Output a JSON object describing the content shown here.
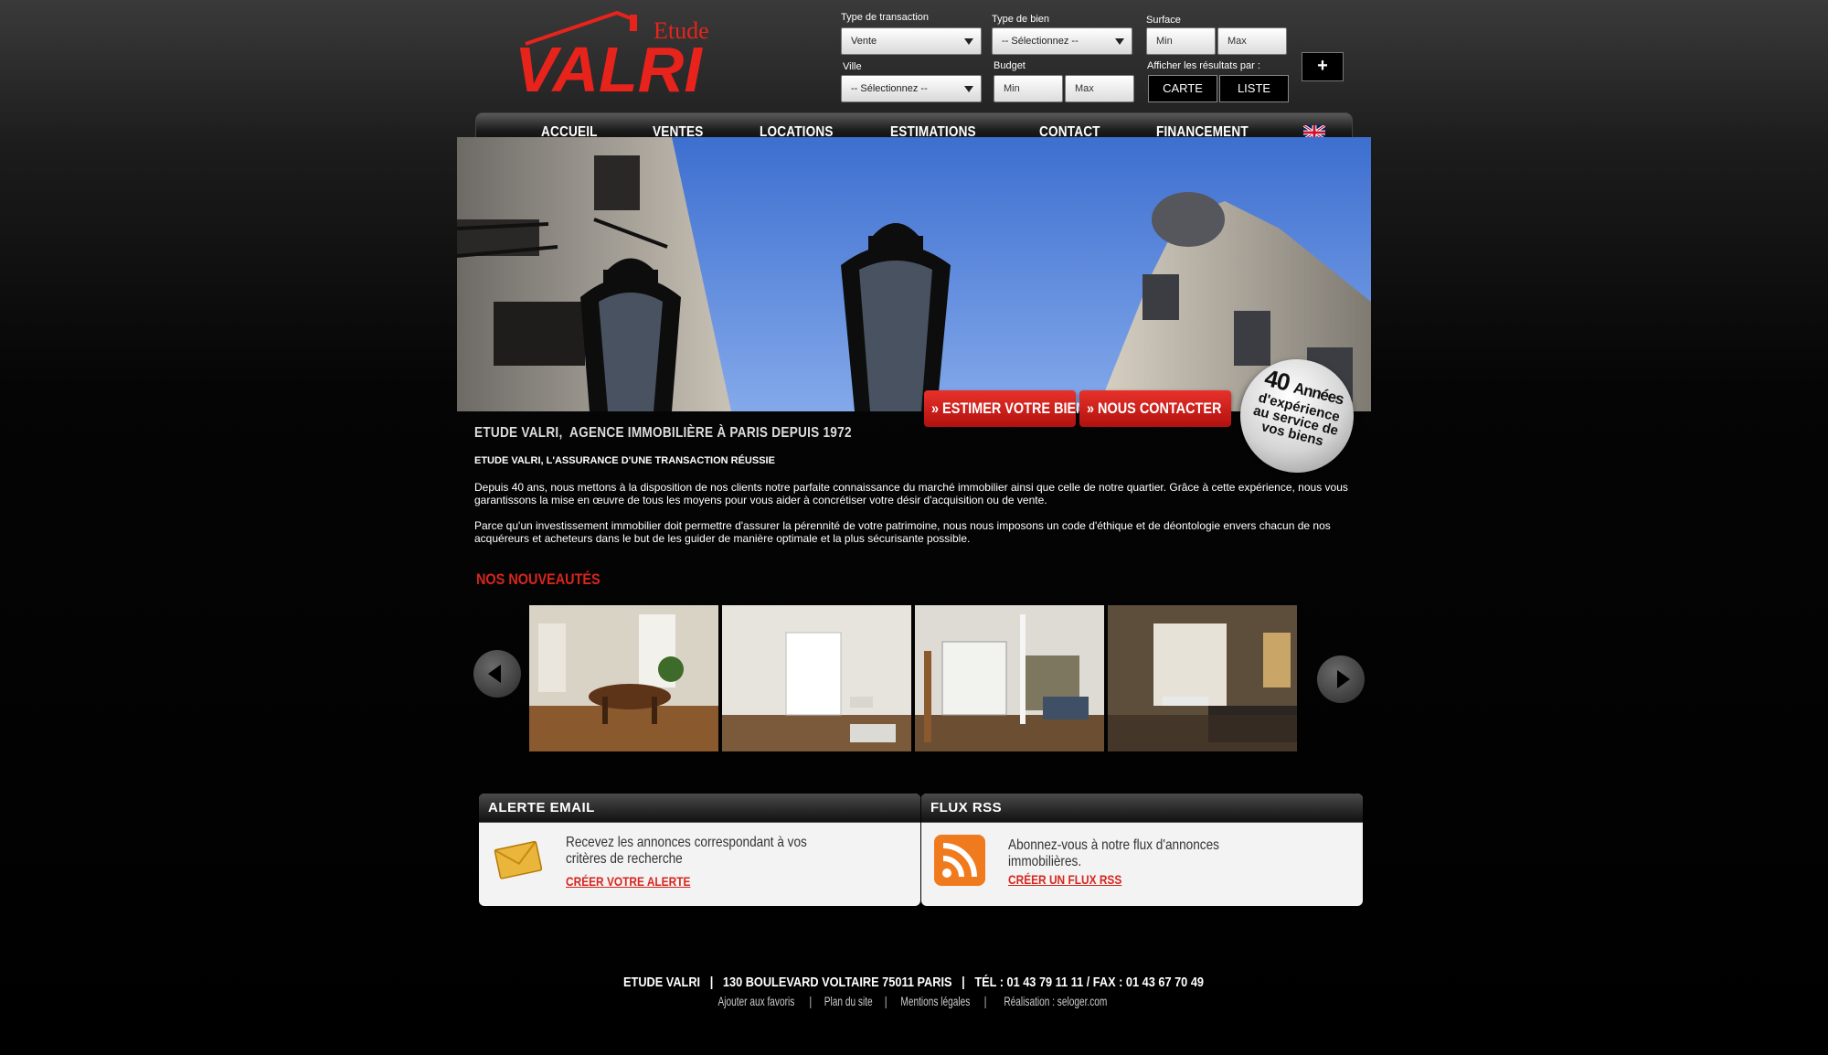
{
  "logo": {
    "top_word": "Etude",
    "main_word": "VALRI",
    "color": "#e8231b"
  },
  "search": {
    "transaction": {
      "label": "Type de transaction",
      "value": "Vente"
    },
    "bien": {
      "label": "Type de bien",
      "value": "-- Sélectionnez --"
    },
    "surface": {
      "label": "Surface",
      "min": "Min",
      "max": "Max"
    },
    "ville": {
      "label": "Ville",
      "value": "-- Sélectionnez --"
    },
    "budget": {
      "label": "Budget",
      "min": "Min",
      "max": "Max"
    },
    "results": {
      "label": "Afficher les résultats par :",
      "carte": "CARTE",
      "liste": "LISTE"
    },
    "plus_label": "+"
  },
  "nav": {
    "items": [
      "ACCUEIL",
      "VENTES",
      "LOCATIONS",
      "ESTIMATIONS",
      "CONTACT",
      "FINANCEMENT"
    ],
    "flag_icon": "uk-flag-icon"
  },
  "banner": {
    "cta_estimer": "» ESTIMER VOTRE BIEN",
    "cta_contact": "» NOUS CONTACTER",
    "badge_num": "40",
    "badge_word": "Années",
    "badge_line1": "d'expérience",
    "badge_line2": "au service de",
    "badge_line3": "vos biens"
  },
  "intro": {
    "title": "ETUDE VALRI,  AGENCE IMMOBILIÈRE À PARIS DEPUIS 1972",
    "subtitle": "ETUDE VALRI, L'ASSURANCE D'UNE TRANSACTION RÉUSSIE",
    "p1": "Depuis 40 ans, nous mettons à la disposition de nos clients notre parfaite connaissance du marché immobilier ainsi que celle de notre quartier. Grâce à cette expérience, nous vous garantissons la mise en œuvre de tous les moyens pour vous aider à concrétiser votre désir d'acquisition ou de vente.",
    "p2": "Parce qu'un investissement immobilier doit permettre d'assurer la pérennité de votre patrimoine, nous nous imposons un code d'éthique et de déontologie envers chacun de nos acquéreurs et acheteurs dans le but de les guider de manière optimale et la plus sécurisante possible."
  },
  "news": {
    "title": "NOS NOUVEAUTÉS"
  },
  "widgets": {
    "email": {
      "title": "ALERTE EMAIL",
      "text": "Recevez les annonces correspondant à vos critères de recherche",
      "link": "CRÉER VOTRE ALERTE"
    },
    "rss": {
      "title": "FLUX RSS",
      "text": "Abonnez-vous à notre flux d'annonces immobilières.",
      "link": "CRÉER UN FLUX RSS"
    }
  },
  "footer": {
    "line1": "ETUDE VALRI   |   130 BOULEVARD VOLTAIRE 75011 PARIS   |   TÉL : 01 43 79 11 11 / FAX : 01 43 67 70 49",
    "links": [
      "Ajouter aux favoris",
      "Plan du site",
      "Mentions légales",
      "Réalisation : seloger.com"
    ]
  }
}
